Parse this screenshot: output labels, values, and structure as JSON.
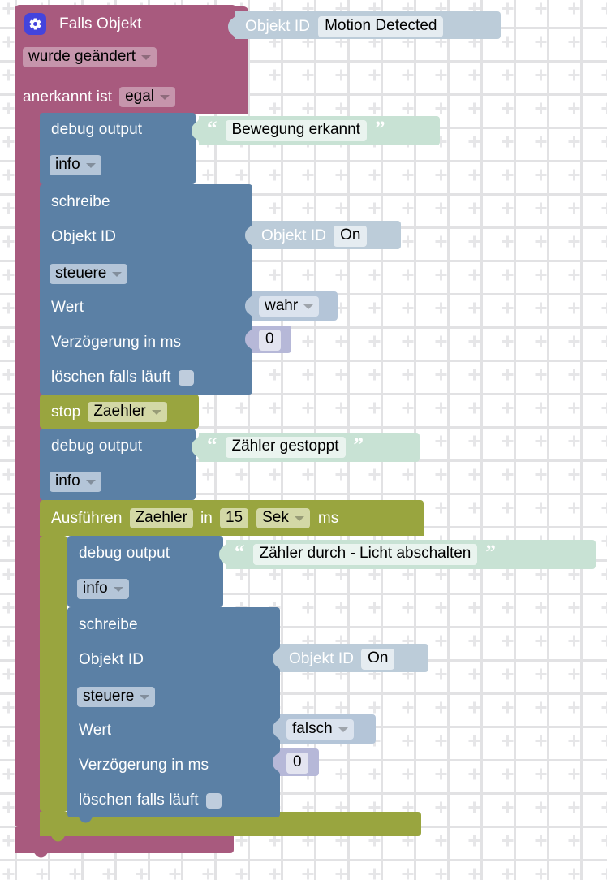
{
  "app": {
    "name": "ioBroker Blockly Script Editor",
    "workspace_background": "#ffffff",
    "grid_mark_color": "#e2e2e4"
  },
  "colors": {
    "trigger_pink": "#a85a7e",
    "trigger_pink_field": "#c695ac",
    "action_blue": "#5b80a5",
    "action_blue_field": "#b4c5d8",
    "timeout_olive": "#99a53f",
    "timeout_olive_field": "#d3d8a6",
    "object_id_steel": "#bcccd9",
    "string_mint": "#c8e2d4",
    "number_lavender": "#b6b8d8",
    "gear_icon_blue": "#4444dd"
  },
  "blocks": {
    "trigger": {
      "type": "on-object-change",
      "gear_icon": "gear-icon",
      "label": "Falls Objekt",
      "object_id_input": {
        "prefix": "Objekt ID",
        "value": "Motion Detected"
      },
      "condition_dropdown": "wurde geändert",
      "ack_label": "anerkannt ist",
      "ack_dropdown": "egal"
    },
    "debug_1": {
      "label": "debug output",
      "severity_dropdown": "info",
      "text": "Bewegung erkannt",
      "quote_open": "“",
      "quote_close": "”"
    },
    "control_1": {
      "label": "schreibe",
      "object_id_label": "Objekt ID",
      "object_id_input": {
        "prefix": "Objekt ID",
        "value": "On"
      },
      "mode_dropdown": "steuere",
      "value_label": "Wert",
      "value_dropdown": "wahr",
      "delay_label": "Verzögerung in ms",
      "delay_value": "0",
      "clear_label": "löschen falls läuft",
      "clear_checked": false
    },
    "stop_timer": {
      "label": "stop",
      "name_dropdown": "Zaehler"
    },
    "debug_2": {
      "label": "debug output",
      "severity_dropdown": "info",
      "text": "Zähler gestoppt",
      "quote_open": "“",
      "quote_close": "”"
    },
    "timeout": {
      "label": "Ausführen",
      "name_dropdown": "Zaehler",
      "in_label": "in",
      "duration": "15",
      "unit_dropdown": "Sek",
      "unit_suffix": "ms"
    },
    "debug_3": {
      "label": "debug output",
      "severity_dropdown": "info",
      "text": "Zähler durch - Licht abschalten",
      "quote_open": "“",
      "quote_close": "”"
    },
    "control_2": {
      "label": "schreibe",
      "object_id_label": "Objekt ID",
      "object_id_input": {
        "prefix": "Objekt ID",
        "value": "On"
      },
      "mode_dropdown": "steuere",
      "value_label": "Wert",
      "value_dropdown": "falsch",
      "delay_label": "Verzögerung in ms",
      "delay_value": "0",
      "clear_label": "löschen falls läuft",
      "clear_checked": false
    }
  }
}
